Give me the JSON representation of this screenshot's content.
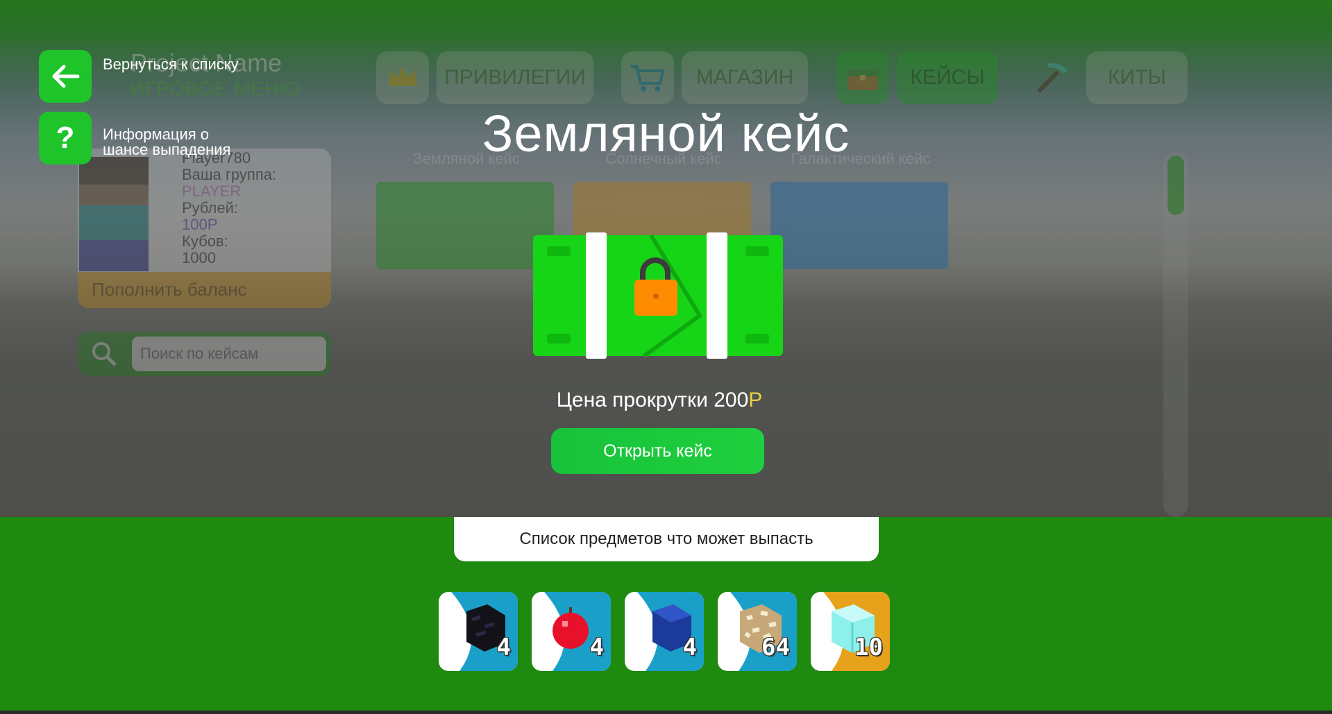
{
  "background_menu": {
    "project_title": "Project Name",
    "menu_subtitle": "ИГРОВОЕ МЕНЮ",
    "tabs": [
      {
        "label": "ПРИВИЛЕГИИ",
        "icon": "crown-icon",
        "active": false
      },
      {
        "label": "МАГАЗИН",
        "icon": "cart-icon",
        "active": false
      },
      {
        "label": "КЕЙСЫ",
        "icon": "chest-icon",
        "active": true
      },
      {
        "label": "КИТЫ",
        "icon": "pickaxe-icon",
        "active": false
      }
    ],
    "profile": {
      "name": "Player780",
      "group_label": "Ваша группа:",
      "group_value": "PLAYER",
      "rubles_label": "Рублей:",
      "rubles_value": "100Р",
      "cubes_label": "Кубов:",
      "cubes_value": "1000",
      "topup_label": "Пополнить баланс"
    },
    "search": {
      "placeholder": "Поиск по кейсам"
    },
    "cases": [
      {
        "label": "Земляной кейс",
        "color": "#2fb32f"
      },
      {
        "label": "Солнечный кейс",
        "color": "#e2a531"
      },
      {
        "label": "Галактический кейс",
        "color": "#2f8ad6"
      }
    ]
  },
  "nav_buttons": {
    "back_label": "Вернуться к списку",
    "info_label": "Информация о шансе выпадения"
  },
  "modal": {
    "title": "Земляной кейс",
    "price_prefix": "Цена прокрутки 200",
    "price_currency": "Р",
    "open_button": "Открыть кейс",
    "items_header": "Список предметов что может выпасть",
    "items": [
      {
        "name": "obsidian",
        "count": "4",
        "bg": "#1aa0c8"
      },
      {
        "name": "apple",
        "count": "4",
        "bg": "#1aa0c8"
      },
      {
        "name": "lapis-block",
        "count": "4",
        "bg": "#1aa0c8"
      },
      {
        "name": "glowstone",
        "count": "64",
        "bg": "#1aa0c8"
      },
      {
        "name": "diamond-block",
        "count": "10",
        "bg": "#e6a21a"
      }
    ]
  },
  "colors": {
    "accent_green": "#1fc42a",
    "panel_green": "#1e8a10",
    "currency_yellow": "#ecd24a"
  }
}
